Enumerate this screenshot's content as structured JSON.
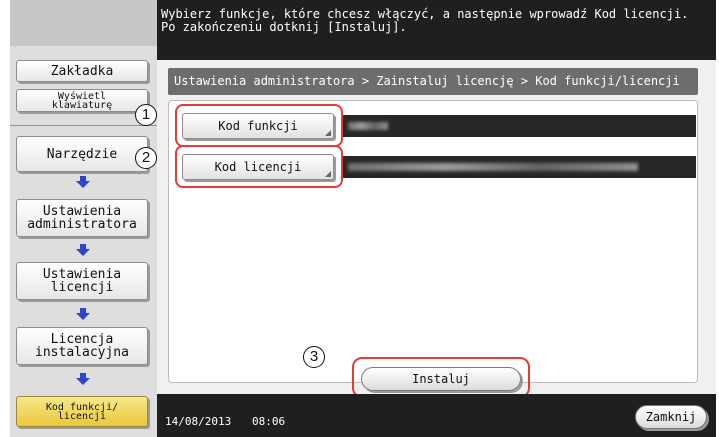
{
  "header": {
    "message": "Wybierz funkcje, które chcesz włączyć, a następnie wprowadź Kod licencji.\nPo zakończeniu dotknij [Instaluj]."
  },
  "sidebar": {
    "bookmark_label": "Zakładka",
    "keyboard_label": "Wyświetl\nklawiaturę",
    "items": [
      {
        "label": "Narzędzie"
      },
      {
        "label": "Ustawienia\nadministratora"
      },
      {
        "label": "Ustawienia\nlicencji"
      },
      {
        "label": "Licencja\ninstalacyjna"
      },
      {
        "label": "Kod funkcji/\nlicencji"
      }
    ]
  },
  "breadcrumb": "Ustawienia administratora > Zainstaluj licencję > Kod funkcji/licencji",
  "fields": [
    {
      "label": "Kod funkcji",
      "callout": "1"
    },
    {
      "label": "Kod licencji",
      "callout": "2"
    }
  ],
  "install": {
    "label": "Instaluj",
    "callout": "3"
  },
  "footer": {
    "date": "14/08/2013",
    "time": "08:06",
    "close_label": "Zamknij"
  },
  "colors": {
    "callout": "#e53a3a",
    "header_bg": "#1f1f1f",
    "highlight": "#e9c83d",
    "arrow": "#2b46c8"
  }
}
